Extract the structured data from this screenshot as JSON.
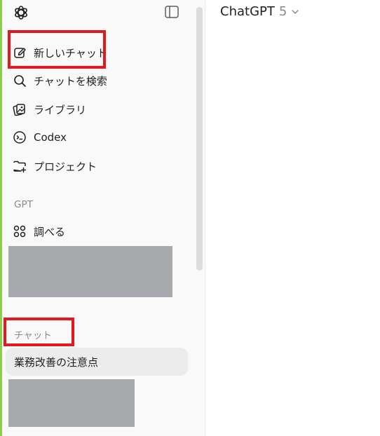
{
  "sidebar": {
    "logo_icon": "openai-logo-icon",
    "toggle_icon": "sidebar-toggle-icon",
    "nav": [
      {
        "label": "新しいチャット",
        "icon": "edit-icon"
      },
      {
        "label": "チャットを検索",
        "icon": "search-icon"
      },
      {
        "label": "ライブラリ",
        "icon": "library-icon"
      },
      {
        "label": "Codex",
        "icon": "codex-icon"
      },
      {
        "label": "プロジェクト",
        "icon": "folder-plus-icon"
      }
    ],
    "gpt_section": {
      "label": "GPT",
      "items": [
        {
          "label": "調べる",
          "icon": "grid-icon"
        }
      ]
    },
    "chat_section": {
      "label": "チャット",
      "items": [
        {
          "label": "業務改善の注意点"
        }
      ]
    },
    "accent_color": "#8ad14a",
    "highlight_color": "#e3191b"
  },
  "header": {
    "model_name": "ChatGPT",
    "model_version": "5",
    "chevron_icon": "chevron-down-icon"
  }
}
